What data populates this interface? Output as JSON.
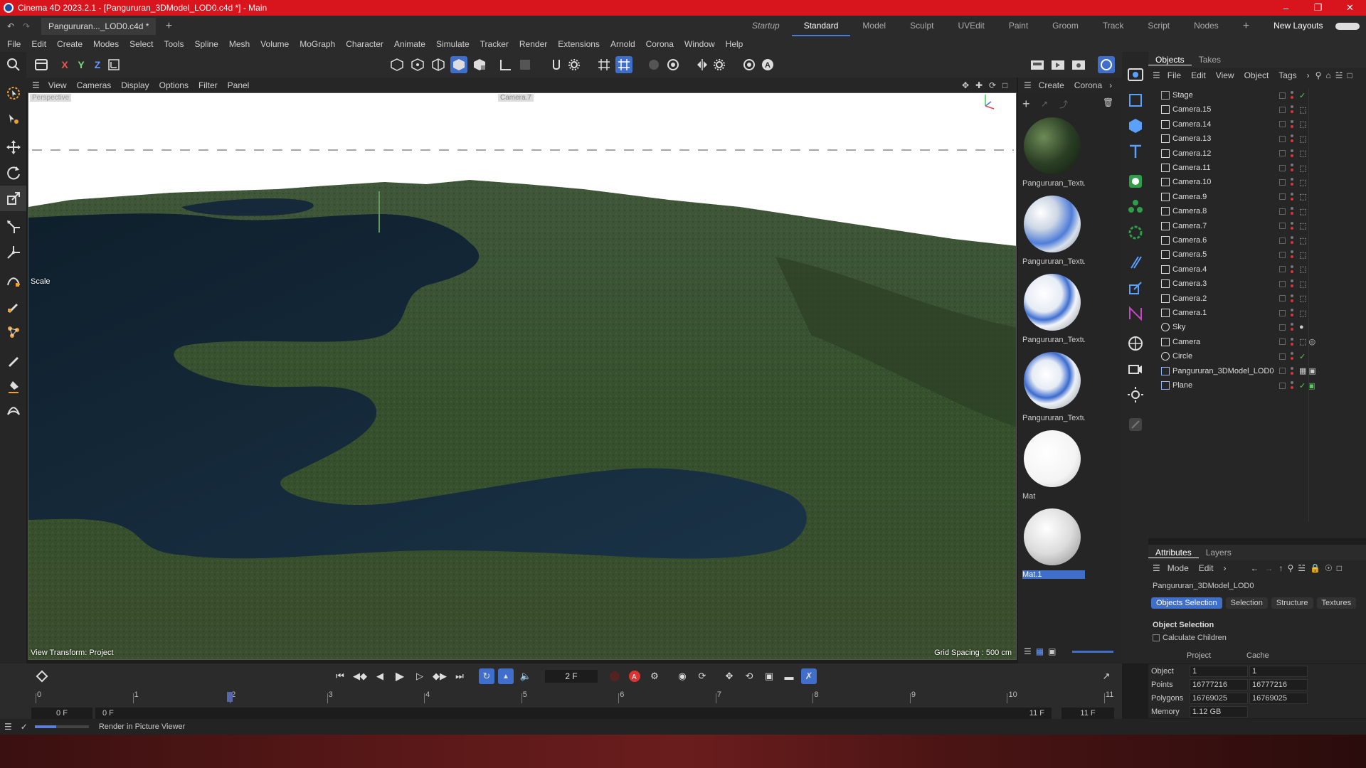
{
  "window": {
    "title": "Cinema 4D 2023.2.1 - [Pangururan_3DModel_LOD0.c4d *] - Main",
    "minimize": "–",
    "restore": "❐",
    "close": "✕"
  },
  "tabrow": {
    "file_tab": "Pangururan..._LOD0.c4d *",
    "add_tab": "+",
    "layouts": [
      "Startup",
      "Standard",
      "Model",
      "Sculpt",
      "UVEdit",
      "Paint",
      "Groom",
      "Track",
      "Script",
      "Nodes"
    ],
    "active_layout": "Standard",
    "new_layouts": "New Layouts"
  },
  "menubar": [
    "File",
    "Edit",
    "Create",
    "Modes",
    "Select",
    "Tools",
    "Spline",
    "Mesh",
    "Volume",
    "MoGraph",
    "Character",
    "Animate",
    "Simulate",
    "Tracker",
    "Render",
    "Extensions",
    "Arnold",
    "Corona",
    "Window",
    "Help"
  ],
  "toolbar": {
    "x_label": "X",
    "y_label": "Y",
    "z_label": "Z"
  },
  "viewport": {
    "menu": [
      "View",
      "Cameras",
      "Display",
      "Options",
      "Filter",
      "Panel"
    ],
    "camera_label": "Perspective",
    "camera_name": "Camera.7",
    "scale_label": "Scale",
    "view_transform": "View Transform: Project",
    "grid_spacing": "Grid Spacing : 500 cm"
  },
  "materials": {
    "menu": [
      "Create",
      "Corona"
    ],
    "items": [
      {
        "label": "Pangururan_Textu",
        "kind": "terrain"
      },
      {
        "label": "Pangururan_Textu",
        "kind": "blue-a"
      },
      {
        "label": "Pangururan_Textu",
        "kind": "blue-b"
      },
      {
        "label": "Pangururan_Textu",
        "kind": "blue-c"
      },
      {
        "label": "Mat",
        "kind": "white"
      },
      {
        "label": "Mat.1",
        "kind": "grey",
        "selected": true
      }
    ]
  },
  "objects": {
    "tabs": [
      "Objects",
      "Takes"
    ],
    "menu": [
      "File",
      "Edit",
      "View",
      "Object",
      "Tags"
    ],
    "rows": [
      {
        "name": "Stage",
        "icon": "stage-icon",
        "tag": "✓"
      },
      {
        "name": "Camera.15",
        "icon": "camera-icon",
        "tag": "⬚"
      },
      {
        "name": "Camera.14",
        "icon": "camera-icon",
        "tag": "⬚"
      },
      {
        "name": "Camera.13",
        "icon": "camera-icon",
        "tag": "⬚"
      },
      {
        "name": "Camera.12",
        "icon": "camera-icon",
        "tag": "⬚"
      },
      {
        "name": "Camera.11",
        "icon": "camera-icon",
        "tag": "⬚"
      },
      {
        "name": "Camera.10",
        "icon": "camera-icon",
        "tag": "⬚"
      },
      {
        "name": "Camera.9",
        "icon": "camera-icon",
        "tag": "⬚"
      },
      {
        "name": "Camera.8",
        "icon": "camera-icon",
        "tag": "⬚"
      },
      {
        "name": "Camera.7",
        "icon": "camera-icon",
        "tag": "⬚"
      },
      {
        "name": "Camera.6",
        "icon": "camera-icon",
        "tag": "⬚"
      },
      {
        "name": "Camera.5",
        "icon": "camera-icon",
        "tag": "⬚"
      },
      {
        "name": "Camera.4",
        "icon": "camera-icon",
        "tag": "⬚"
      },
      {
        "name": "Camera.3",
        "icon": "camera-icon",
        "tag": "⬚"
      },
      {
        "name": "Camera.2",
        "icon": "camera-icon",
        "tag": "⬚"
      },
      {
        "name": "Camera.1",
        "icon": "camera-icon",
        "tag": "⬚"
      },
      {
        "name": "Sky",
        "icon": "sky-icon",
        "tag": "●"
      },
      {
        "name": "Camera",
        "icon": "camera-icon",
        "tag": "⬚ ◎"
      },
      {
        "name": "Circle",
        "icon": "circle-icon",
        "tag": "✓"
      },
      {
        "name": "Pangururan_3DModel_LOD0",
        "icon": "polygon-icon",
        "tag": "▦ ▣"
      },
      {
        "name": "Plane",
        "icon": "plane-icon",
        "tag": "✓ ▣"
      }
    ]
  },
  "attributes": {
    "tabs": [
      "Attributes",
      "Layers"
    ],
    "menu": [
      "Mode",
      "Edit"
    ],
    "object_name": "Pangururan_3DModel_LOD0",
    "sel_tabs": [
      "Objects Selection",
      "Selection",
      "Structure",
      "Textures"
    ],
    "section_title": "Object Selection",
    "calc_children": "Calculate Children",
    "col_project": "Project",
    "col_cache": "Cache",
    "rows": [
      {
        "k": "Object",
        "project": "1",
        "cache": "1"
      },
      {
        "k": "Points",
        "project": "16777216",
        "cache": "16777216"
      },
      {
        "k": "Polygons",
        "project": "16769025",
        "cache": "16769025"
      },
      {
        "k": "Memory",
        "project": "1.12 GB",
        "cache": ""
      }
    ]
  },
  "timeline": {
    "current_frame": "2 F",
    "start_field": "0 F",
    "start_field2": "0 F",
    "end_field": "11 F",
    "end_field2": "11 F",
    "ticks": [
      "0",
      "1",
      "2",
      "3",
      "4",
      "5",
      "6",
      "7",
      "8",
      "9",
      "10",
      "11"
    ],
    "playhead_frame": 2
  },
  "status": {
    "text": "Render in Picture Viewer"
  },
  "colors": {
    "titlebar": "#d8151c",
    "accent": "#3f6fcb",
    "water": "#142738",
    "land": "#2f4527"
  }
}
